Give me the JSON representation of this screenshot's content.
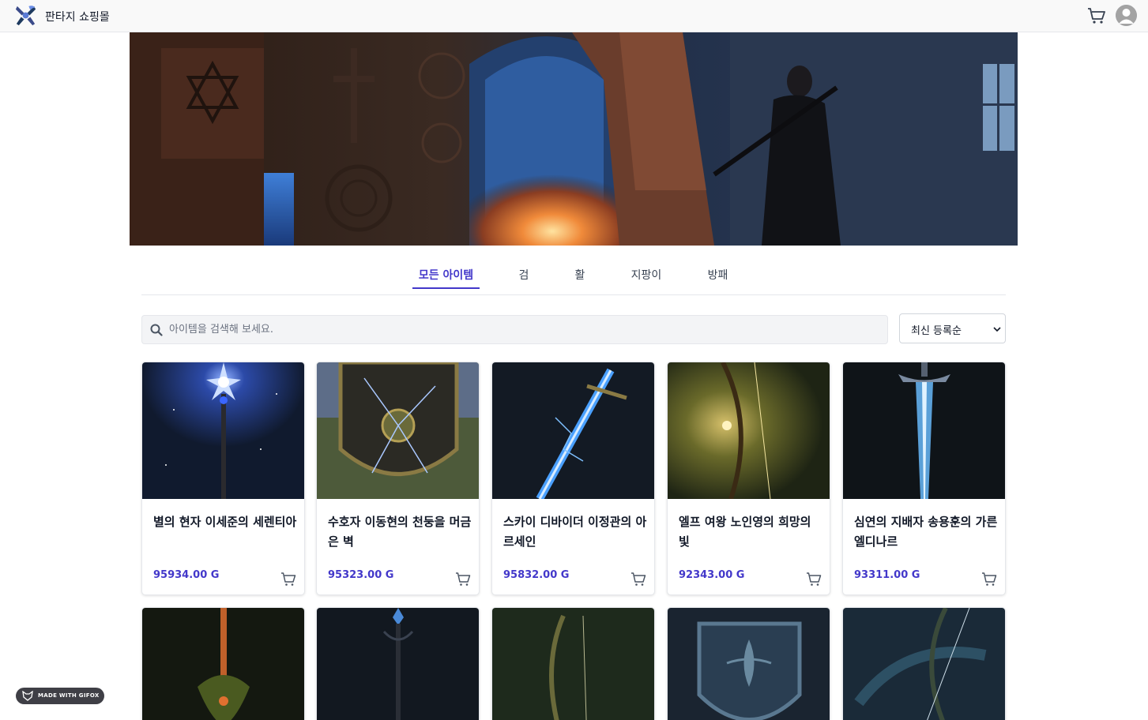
{
  "header": {
    "brand": "판타지 쇼핑몰",
    "logo_icon": "crossed-tools-logo-icon",
    "cart_icon": "cart-icon",
    "avatar_icon": "user-avatar-icon"
  },
  "tabs": [
    {
      "label": "모든 아이템",
      "active": true
    },
    {
      "label": "검",
      "active": false
    },
    {
      "label": "활",
      "active": false
    },
    {
      "label": "지팡이",
      "active": false
    },
    {
      "label": "방패",
      "active": false
    }
  ],
  "search": {
    "placeholder": "아이템을 검색해 보세요.",
    "value": ""
  },
  "sort": {
    "selected": "최신 등록순"
  },
  "products": [
    {
      "name": "별의 현자 이세준의 세렌티아",
      "price": "95934.00 G",
      "image": "starlight-staff"
    },
    {
      "name": "수호자 이동현의 천둥을 머금은 벽",
      "price": "95323.00 G",
      "image": "thunder-shield"
    },
    {
      "name": "스카이 디바이더 이정관의 아르세인",
      "price": "95832.00 G",
      "image": "lightning-sword"
    },
    {
      "name": "엘프 여왕 노인영의 희망의 빛",
      "price": "92343.00 G",
      "image": "golden-bow"
    },
    {
      "name": "심연의 지배자 송용훈의 가른 엘디나르",
      "price": "93311.00 G",
      "image": "ice-sword"
    },
    {
      "name": "",
      "price": "",
      "image": "flame-sword"
    },
    {
      "name": "",
      "price": "",
      "image": "dark-staff"
    },
    {
      "name": "",
      "price": "",
      "image": "forest-bow"
    },
    {
      "name": "",
      "price": "",
      "image": "ornate-shield"
    },
    {
      "name": "",
      "price": "",
      "image": "mist-bow"
    }
  ],
  "badge": {
    "label": "MADE WITH GIFOX"
  },
  "colors": {
    "accent": "#4338ca",
    "header_bg": "#f9f9f9",
    "badge_bg": "#3f3f46"
  }
}
